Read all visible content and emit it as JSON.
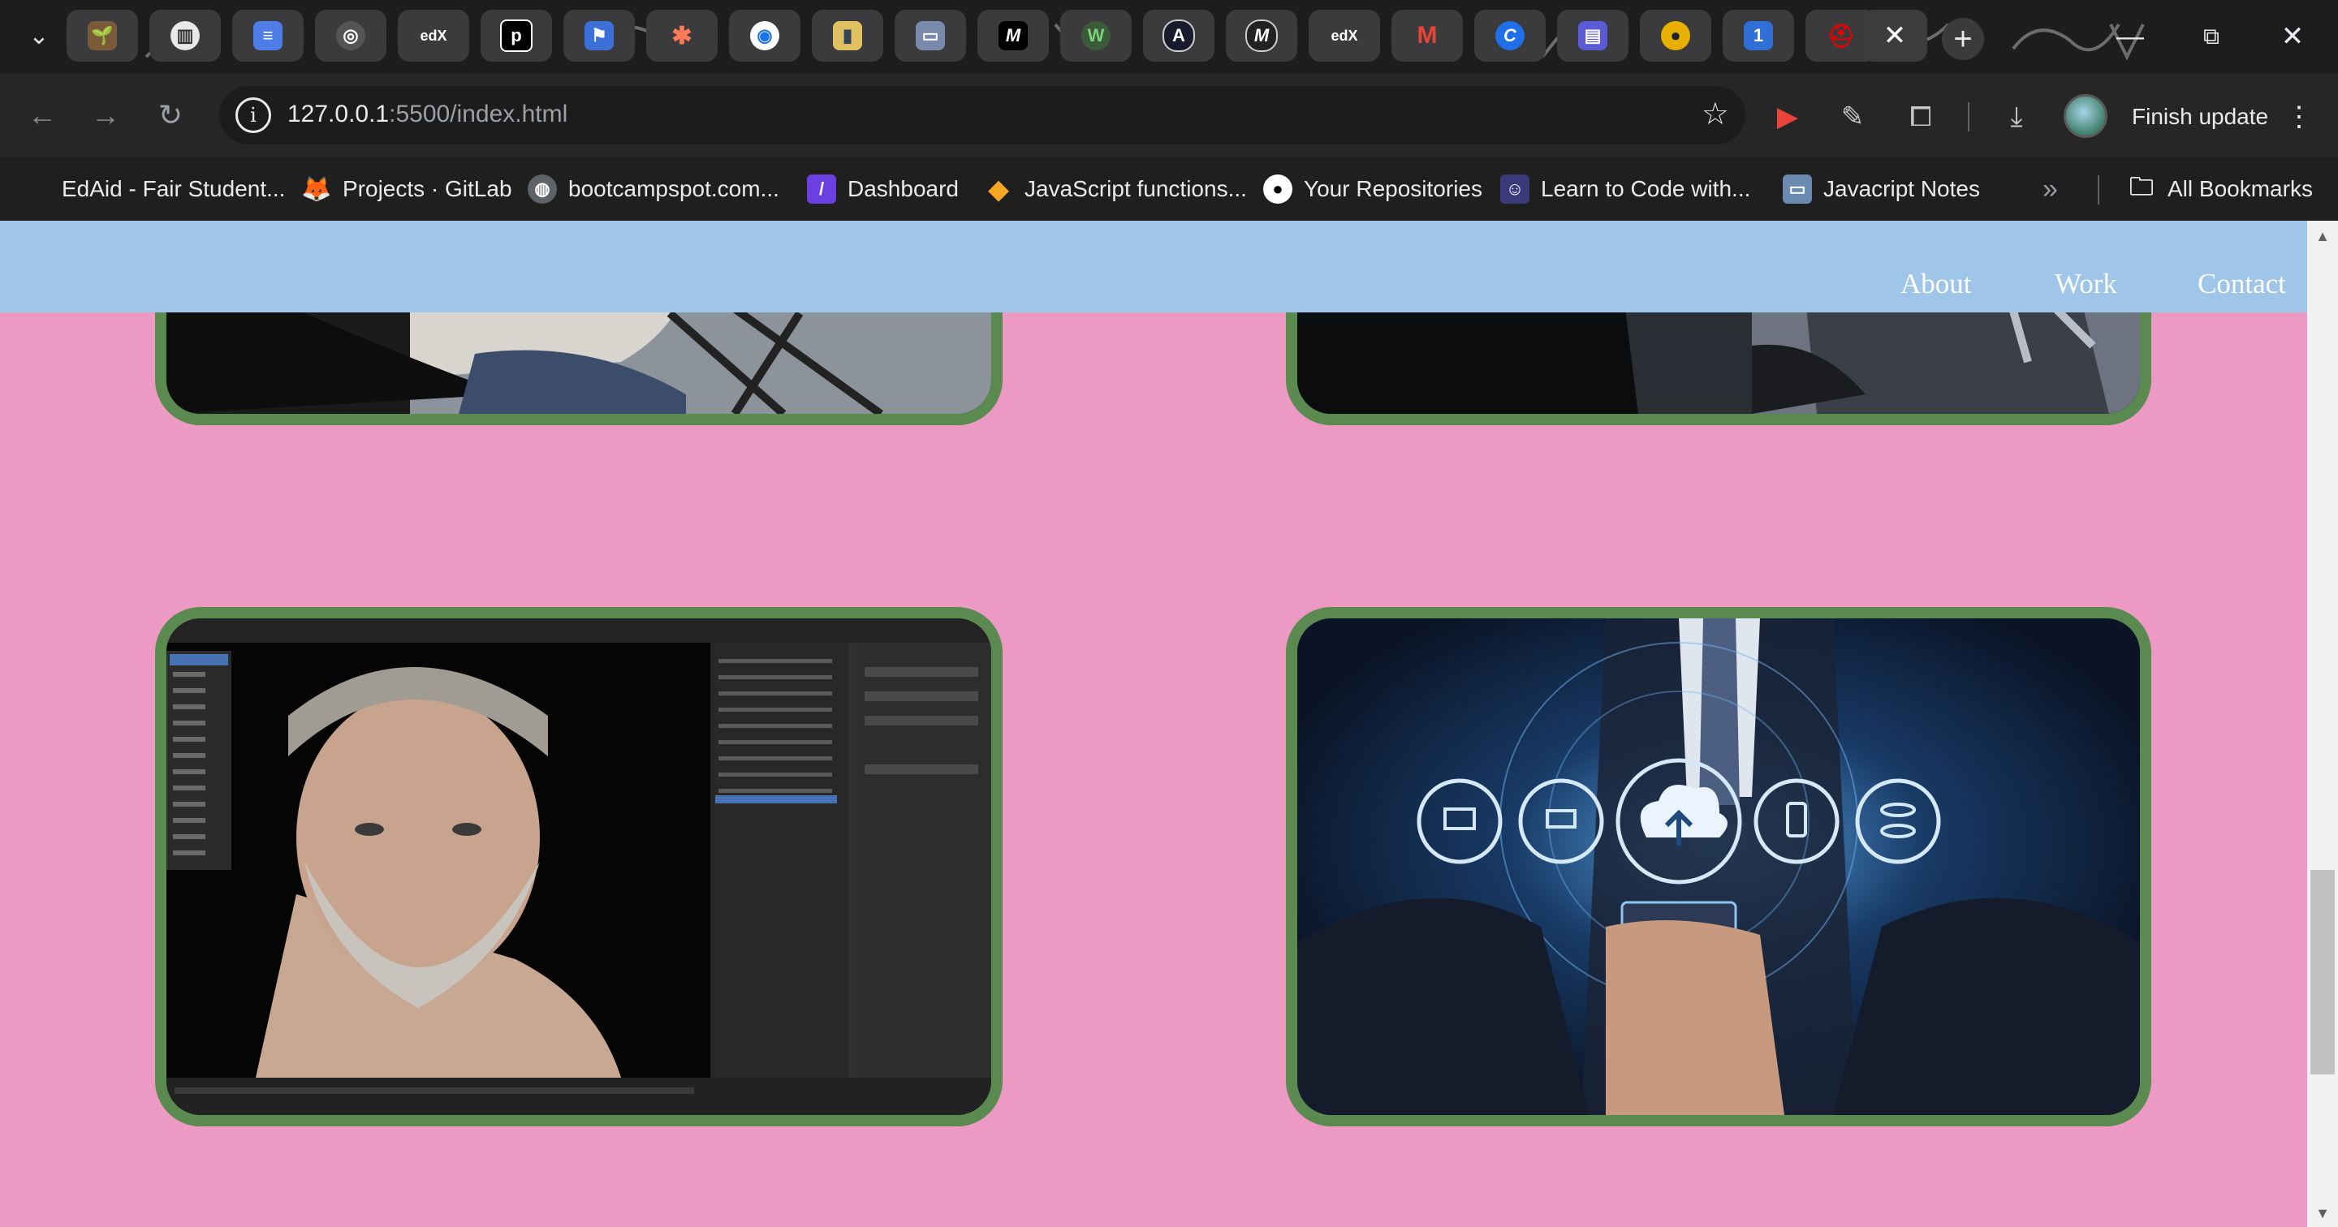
{
  "tabs": [
    {
      "icon": "plant-icon"
    },
    {
      "icon": "trello-icon"
    },
    {
      "icon": "docs-icon"
    },
    {
      "icon": "edx-ring-icon"
    },
    {
      "icon": "edx-icon",
      "text": "edX"
    },
    {
      "icon": "p-icon",
      "text": "p"
    },
    {
      "icon": "flag-icon"
    },
    {
      "icon": "asterisk-icon"
    },
    {
      "icon": "target-icon"
    },
    {
      "icon": "notebook-icon"
    },
    {
      "icon": "tv-icon"
    },
    {
      "icon": "m-icon",
      "text": "M"
    },
    {
      "icon": "w-icon",
      "text": "W"
    },
    {
      "icon": "a-icon",
      "text": "A"
    },
    {
      "icon": "m-circle-icon",
      "text": "M"
    },
    {
      "icon": "edx-icon",
      "text": "edX"
    },
    {
      "icon": "gmail-icon",
      "text": "M"
    },
    {
      "icon": "c-icon",
      "text": "C"
    },
    {
      "icon": "screen-icon"
    },
    {
      "icon": "coin-icon"
    },
    {
      "icon": "one-icon",
      "text": "1"
    },
    {
      "icon": "redhat-icon"
    }
  ],
  "address_bar": {
    "host": "127.0.0.1",
    "path": ":5500/index.html"
  },
  "toolbar": {
    "finish_update": "Finish update"
  },
  "bookmarks": [
    {
      "label": "EdAid - Fair Student...",
      "icon": "edaid-icon"
    },
    {
      "label": "Projects · GitLab",
      "icon": "gitlab-icon"
    },
    {
      "label": "bootcampspot.com...",
      "icon": "globe-icon"
    },
    {
      "label": "Dashboard",
      "icon": "dashboard-icon"
    },
    {
      "label": "JavaScript functions...",
      "icon": "diamond-icon"
    },
    {
      "label": "Your Repositories",
      "icon": "github-icon"
    },
    {
      "label": "Learn to Code with...",
      "icon": "robot-icon"
    },
    {
      "label": "Javacript Notes",
      "icon": "monitor-icon"
    }
  ],
  "all_bookmarks": "All Bookmarks",
  "site_nav": {
    "about": "About",
    "work": "Work",
    "contact": "Contact"
  },
  "colors": {
    "page_bg": "#ec9ac4",
    "nav_bg": "#9fc5e8",
    "card_border": "#5a8a4f"
  }
}
